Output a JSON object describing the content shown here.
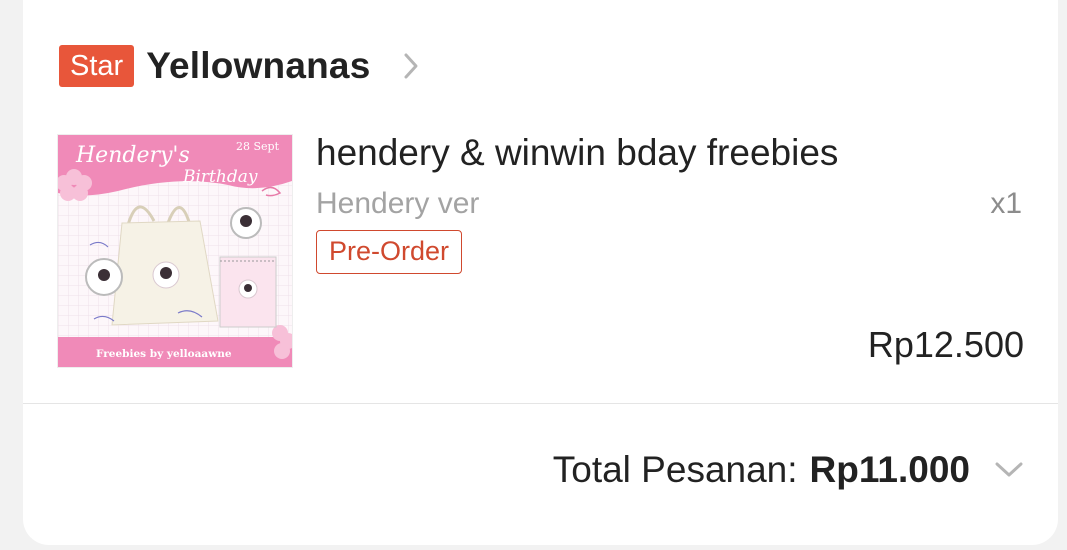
{
  "shop": {
    "badge": "Star",
    "name": "Yellownanas"
  },
  "product": {
    "title": "hendery & winwin bday freebies",
    "variant": "Hendery ver",
    "quantity": "x1",
    "tag": "Pre-Order",
    "price": "Rp12.500",
    "image": {
      "heading_line1": "Hendery's",
      "heading_line2": "Birthday",
      "date": "28 Sept",
      "footer": "Freebies by yelloaawne"
    }
  },
  "order": {
    "total_label": "Total Pesanan:",
    "total_value": "Rp11.000"
  },
  "colors": {
    "badge": "#e8563a",
    "tag": "#d0492e",
    "image_pink": "#f08ab8"
  }
}
